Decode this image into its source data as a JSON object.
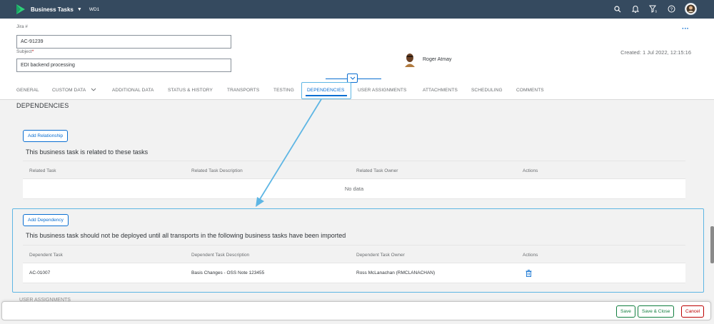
{
  "shell": {
    "app_title": "Business Tasks",
    "system_id": "WD1",
    "icons": [
      "search-icon",
      "bell-icon",
      "filter-icon",
      "help-icon",
      "user-avatar"
    ]
  },
  "header": {
    "jira_label": "Jira #",
    "jira_value": "AC-91239",
    "subject_label": "Subject",
    "subject_required": "*",
    "subject_value": "EDI backend processing",
    "owner_name": "Roger Atmay",
    "created": "Created: 1 Jul 2022, 12:15:16",
    "more": "···"
  },
  "tabs": [
    {
      "label": "GENERAL"
    },
    {
      "label": "CUSTOM DATA"
    },
    {
      "label": "ADDITIONAL DATA"
    },
    {
      "label": "STATUS & HISTORY"
    },
    {
      "label": "TRANSPORTS"
    },
    {
      "label": "TESTING"
    },
    {
      "label": "DEPENDENCIES"
    },
    {
      "label": "USER ASSIGNMENTS"
    },
    {
      "label": "ATTACHMENTS"
    },
    {
      "label": "SCHEDULING"
    },
    {
      "label": "COMMENTS"
    }
  ],
  "content": {
    "section_title": "DEPENDENCIES",
    "relationships": {
      "button": "Add Relationship",
      "description": "This business task is related to these tasks",
      "columns": [
        "Related Task",
        "Related Task Description",
        "Related Task Owner",
        "Actions"
      ],
      "empty": "No data"
    },
    "dependencies": {
      "button": "Add Dependency",
      "description": "This business task should not be deployed until all transports in the following business tasks have been imported",
      "columns": [
        "Dependent Task",
        "Dependent Task Description",
        "Dependent Task Owner",
        "Actions"
      ],
      "rows": [
        {
          "task": "AC-01007",
          "description": "Basis Changes - OSS Note 123455",
          "owner": "Ross McLanachan (RMCLANACHAN)",
          "action_icon": "trash-icon"
        }
      ]
    },
    "peek_text": "USER ASSIGNMENTS"
  },
  "footer": {
    "save": "Save",
    "save_close": "Save & Close",
    "cancel": "Cancel"
  },
  "colors": {
    "shell_bg": "#354a5f",
    "accent": "#0a6ed1",
    "highlight": "#5eb6e4",
    "save_green": "#107e3e",
    "cancel_red": "#bb0000"
  }
}
